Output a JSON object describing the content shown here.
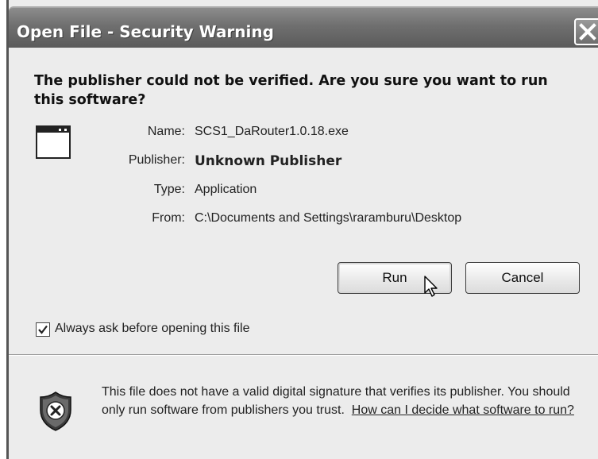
{
  "window": {
    "title": "Open File - Security Warning"
  },
  "heading": "The publisher could not be verified.  Are you sure you want to run this software?",
  "file_info": [
    {
      "label": "Name:",
      "value": "SCS1_DaRouter1.0.18.exe"
    },
    {
      "label": "Publisher:",
      "value": "Unknown Publisher"
    },
    {
      "label": "Type:",
      "value": "Application"
    },
    {
      "label": "From:",
      "value": "C:\\Documents and Settings\\raramburu\\Desktop"
    }
  ],
  "buttons": {
    "run": "Run",
    "cancel": "Cancel"
  },
  "checkbox": {
    "label": "Always ask before opening this file",
    "checked": true
  },
  "warning": {
    "text": "This file does not have a valid digital signature that verifies its publisher. You should only run software from publishers you trust.",
    "link": "How can I decide what software to run?"
  },
  "icons": {
    "close": "close-icon",
    "file": "application-window-icon",
    "checkmark": "checkmark-icon",
    "shield": "security-shield-icon",
    "cursor": "mouse-pointer-icon"
  }
}
